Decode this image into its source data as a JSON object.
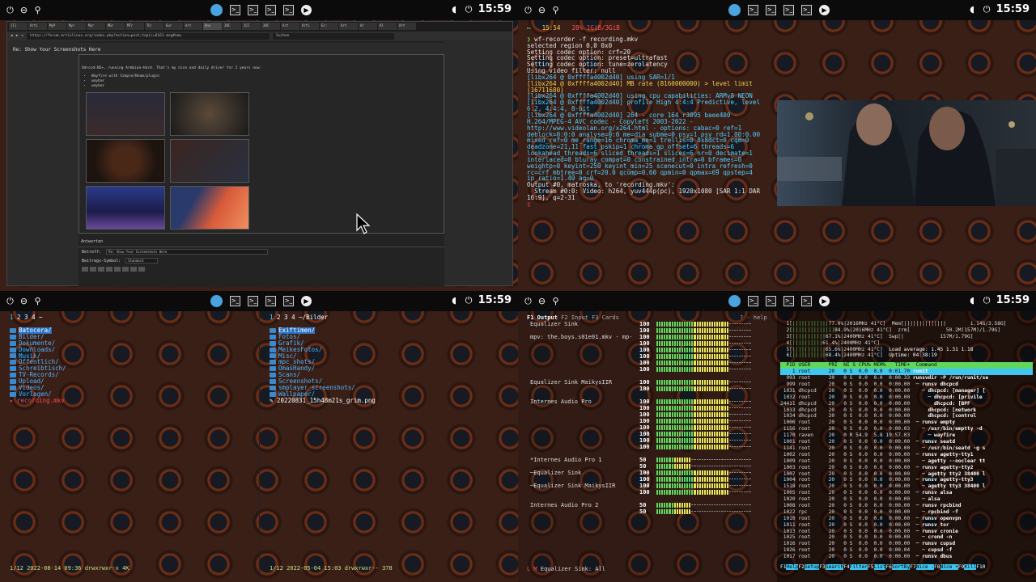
{
  "bar": {
    "clock": "15:59",
    "term_glyph": ">_"
  },
  "browser": {
    "tabs": [
      "[1]",
      "Arti",
      "MyP",
      "Myr",
      "Myr",
      "MGr",
      "MTr",
      "TO:",
      "Gur",
      "Art",
      "Ans",
      "20C",
      "2CC",
      "20C",
      "Art",
      "Arti",
      "Gr:",
      "Art",
      "Ar",
      "Al",
      "Art"
    ],
    "url": "https://forum.artixlinux.org/index.php?action=post;topic=6161.msg#new",
    "search_placeholder": "Suchen",
    "post_title": "Re: Show Your Screenshots Here",
    "post_intro": "Odroid-N2+, running Armbian-Hard. That's my nice and daily driver for 2 years now:",
    "post_items": [
      "Wayfire with Simple/Beam/plugin",
      "waybar",
      "waybar"
    ],
    "answer_title": "Antworten",
    "betreff_label": "Betreff:",
    "betreff_value": "Re: Show Your Screenshots Here",
    "symbol_label": "Beitrags-Symbol:",
    "symbol_value": "Standard"
  },
  "terminal": {
    "status_time": "15:54",
    "status_mem": "28% 1GiB/3GiB",
    "command": "wf-recorder -f recording.mkv",
    "lines": [
      {
        "t": "selected region 0,0 0x0",
        "c": ""
      },
      {
        "t": "Setting codec option: crf=20",
        "c": ""
      },
      {
        "t": "Setting codec option: preset=ultrafast",
        "c": ""
      },
      {
        "t": "Setting codec option: tune=zerolatency",
        "c": ""
      },
      {
        "t": "Using video filter: null",
        "c": ""
      },
      {
        "t": "[libx264 @ 0xffffa4002d40] using SAR=1/1",
        "c": "cyan"
      },
      {
        "t": "[libx264 @ 0xffffa4002d40] MB rate (8160000000) > level limit (16711680)",
        "c": "yel"
      },
      {
        "t": "[libx264 @ 0xffffa4002d40] using cpu capabilities: ARMv8 NEON",
        "c": "cyan"
      },
      {
        "t": "[libx264 @ 0xffffa4002d40] profile High 4:4:4 Predictive, level 6.2, 4:4:4, 8-bit",
        "c": "cyan"
      },
      {
        "t": "[libx264 @ 0xffffa4002d40] 264 - core 164 r3095 baee400 - H.264/MPEG-4 AVC codec - Copyleft 2003-2022 - http://www.videolan.org/x264.html - options: cabac=0 ref=1 deblock=0:0:0 analyse=0:0 me=dia subme=0 psy=1 psy_rd=1.00:0.00 mixed_ref=0 me_range=16 chroma_me=1 trellis=0 8x8dct=0 cqm=0 deadzone=21,11 fast_pskip=1 chroma_qp_offset=6 threads=6 lookahead_threads=6 sliced_threads=1 slices=6 nr=0 decimate=1 interlaced=0 bluray_compat=0 constrained_intra=0 bframes=0 weightp=0 keyint=250 keyint_min=25 scenecut=0 intra_refresh=0 rc=crf mbtree=0 crf=20.0 qcomp=0.60 qpmin=0 qpmax=69 qpstep=4 ip_ratio=1.40 aq=0",
        "c": "cyan"
      },
      {
        "t": "Output #0, matroska, to 'recording.mkv':",
        "c": ""
      },
      {
        "t": "  Stream #0:0: Video: h264, yuv444p(pc), 1920x1080 [SAR 1:1 DAR 16:9], q=2-31",
        "c": ""
      }
    ]
  },
  "ranger_left": {
    "tabs_cur": "1",
    "tabs_rest": "2 3 4 ~",
    "items": [
      {
        "name": "Batocera/",
        "type": "dir",
        "sel": true
      },
      {
        "name": "Bilder/",
        "type": "dir"
      },
      {
        "name": "Dokumente/",
        "type": "dir"
      },
      {
        "name": "Downloads/",
        "type": "dir"
      },
      {
        "name": "Musik/",
        "type": "dir"
      },
      {
        "name": "Öffentlich/",
        "type": "dir"
      },
      {
        "name": "Schreibtisch/",
        "type": "dir"
      },
      {
        "name": "TV-Records/",
        "type": "dir"
      },
      {
        "name": "Upload/",
        "type": "dir"
      },
      {
        "name": "Videos/",
        "type": "dir"
      },
      {
        "name": "Vorlagen/",
        "type": "dir"
      },
      {
        "name": "recording.mkv",
        "type": "file"
      }
    ],
    "status": "1/12 2022-08-14 09:36 drwxrwxr-x 4K"
  },
  "ranger_right": {
    "tabs_cur": "1",
    "tabs_rest": "2 3 4 ~/Bilder",
    "items": [
      {
        "name": "Exiftimen/",
        "type": "dir",
        "sel": true
      },
      {
        "name": "Fotos/",
        "type": "dir"
      },
      {
        "name": "Grafik/",
        "type": "dir"
      },
      {
        "name": "MeikesFotos/",
        "type": "dir"
      },
      {
        "name": "Misc/",
        "type": "dir"
      },
      {
        "name": "mpc_shots/",
        "type": "dir"
      },
      {
        "name": "OmasHandy/",
        "type": "dir"
      },
      {
        "name": "Scans/",
        "type": "dir"
      },
      {
        "name": "Screenshots/",
        "type": "dir"
      },
      {
        "name": "smplayer_screenshots/",
        "type": "dir"
      },
      {
        "name": "Wallpaper/",
        "type": "dir"
      },
      {
        "name": "20220831_15h48m21s_grim.png",
        "type": "img"
      }
    ],
    "status": "1/12 2022-05-04 15:03 drwxrwxr-- 378"
  },
  "mixer": {
    "tab_output": "F1 Output",
    "tab_input": "F2 Input",
    "tab_cards": "F3 Cards",
    "help": "? - help",
    "footer": "Equalizer Sink: All",
    "footer_prefix": "L M",
    "channels": [
      {
        "name": "Equalizer Sink",
        "vol": "100",
        "lvl": 1.0,
        "header": true
      },
      {
        "name": "",
        "vol": "100",
        "lvl": 1.0
      },
      {
        "name": "mpv: the.boys.s01e01.mkv - mp-",
        "vol": "100",
        "lvl": 1.0
      },
      {
        "name": "",
        "vol": "100",
        "lvl": 1.0
      },
      {
        "name": "",
        "vol": "100",
        "lvl": 1.0
      },
      {
        "name": "",
        "vol": "100",
        "lvl": 1.0
      },
      {
        "name": "",
        "vol": "100",
        "lvl": 1.0
      },
      {
        "name": "",
        "vol": "100",
        "lvl": 1.0
      },
      {
        "name": "",
        "gap": true
      },
      {
        "name": "Equalizer Sink MaikysIIR",
        "vol": "100",
        "lvl": 1.0
      },
      {
        "name": "",
        "vol": "100",
        "lvl": 1.0
      },
      {
        "name": "",
        "gap": true
      },
      {
        "name": "Internes Audio Pro",
        "vol": "100",
        "lvl": 1.0
      },
      {
        "name": "",
        "vol": "100",
        "lvl": 1.0
      },
      {
        "name": "",
        "vol": "100",
        "lvl": 1.0
      },
      {
        "name": "",
        "vol": "100",
        "lvl": 1.0
      },
      {
        "name": "",
        "vol": "100",
        "lvl": 1.0
      },
      {
        "name": "",
        "vol": "100",
        "lvl": 1.0
      },
      {
        "name": "",
        "vol": "100",
        "lvl": 1.0
      },
      {
        "name": "",
        "vol": "100",
        "lvl": 1.0
      },
      {
        "name": "",
        "gap": true
      },
      {
        "name": "*Internes Audio Pro 1",
        "vol": "50",
        "lvl": 0.5
      },
      {
        "name": "",
        "vol": "50",
        "lvl": 0.5
      },
      {
        "name": "─Equalizer Sink",
        "vol": "100",
        "lvl": 1.0
      },
      {
        "name": "",
        "vol": "100",
        "lvl": 1.0
      },
      {
        "name": "─Equalizer Sink MaikysIIR",
        "vol": "100",
        "lvl": 1.0
      },
      {
        "name": "",
        "vol": "100",
        "lvl": 1.0
      },
      {
        "name": "",
        "gap": true
      },
      {
        "name": "Internes Audio Pro 2",
        "vol": "50",
        "lvl": 0.5
      },
      {
        "name": "",
        "vol": "50",
        "lvl": 0.5
      }
    ]
  },
  "htop": {
    "cpus": [
      {
        "n": "1",
        "pct": "77.0%",
        "mhz": "2016MHz",
        "temp": "41°C",
        "lvl": 0.77
      },
      {
        "n": "2",
        "pct": "84.9%",
        "mhz": "2016MHz",
        "temp": "41°C",
        "lvl": 0.85
      },
      {
        "n": "3",
        "pct": "67.1%",
        "mhz": "2400MHz",
        "temp": "41°C",
        "lvl": 0.67
      },
      {
        "n": "4",
        "pct": "61.4%",
        "mhz": "2400MHz",
        "temp": "41°C",
        "lvl": 0.61
      },
      {
        "n": "5",
        "pct": "65.6%",
        "mhz": "2400MHz",
        "temp": "41°C",
        "lvl": 0.66
      },
      {
        "n": "6",
        "pct": "68.4%",
        "mhz": "2400MHz",
        "temp": "41°C",
        "lvl": 0.68
      }
    ],
    "mem": "1.14G/3.58G",
    "zrm": "50.2M(157M)/1.79G",
    "swp": "157M/1.79G",
    "load": "Load average: 1.45 1.31 1.18",
    "uptime": "Uptime: 04:38:19",
    "header": "  PID USER      PRI  NI S CPU% MEM%   TIME+  Command",
    "procs": [
      {
        "pid": "1",
        "user": "root",
        "pri": "20",
        "ni": "0",
        "s": "S",
        "cpu": "0.0",
        "mem": "0.0",
        "time": "0:01.70",
        "cmd": "runit",
        "sel": true
      },
      {
        "pid": "993",
        "user": "root",
        "pri": "20",
        "ni": "0",
        "s": "S",
        "cpu": "0.0",
        "mem": "0.0",
        "time": "0:00.33",
        "cmd": "runsvdir -P /run/runit/se"
      },
      {
        "pid": "999",
        "user": "root",
        "pri": "20",
        "ni": "0",
        "s": "S",
        "cpu": "0.0",
        "mem": "0.0",
        "time": "0:00.00",
        "cmd": " ─ runsv dhcpcd"
      },
      {
        "pid": "1031",
        "user": "dhcpcd",
        "pri": "20",
        "ni": "0",
        "s": "S",
        "cpu": "0.0",
        "mem": "0.0",
        "time": "0:00.00",
        "cmd": "   ─ dhcpcd: [manager] ["
      },
      {
        "pid": "1032",
        "user": "root",
        "pri": "20",
        "ni": "0",
        "s": "S",
        "cpu": "0.0",
        "mem": "0.0",
        "time": "0:00.00",
        "cmd": "     ─ dhcpcd: [privile"
      },
      {
        "pid": "24411",
        "user": "dhcpcd",
        "pri": "20",
        "ni": "0",
        "s": "S",
        "cpu": "0.0",
        "mem": "0.0",
        "time": "0:00.00",
        "cmd": "       dhcpcd: [BPF"
      },
      {
        "pid": "1033",
        "user": "dhcpcd",
        "pri": "20",
        "ni": "0",
        "s": "S",
        "cpu": "0.0",
        "mem": "0.0",
        "time": "0:00.00",
        "cmd": "     dhcpcd: [network"
      },
      {
        "pid": "1034",
        "user": "dhcpcd",
        "pri": "20",
        "ni": "0",
        "s": "S",
        "cpu": "0.0",
        "mem": "0.0",
        "time": "0:00.00",
        "cmd": "     dhcpcd: [control"
      },
      {
        "pid": "1000",
        "user": "root",
        "pri": "20",
        "ni": "0",
        "s": "S",
        "cpu": "0.0",
        "mem": "0.0",
        "time": "0:00.00",
        "cmd": " ─ runsv empty"
      },
      {
        "pid": "1156",
        "user": "root",
        "pri": "20",
        "ni": "0",
        "s": "S",
        "cpu": "0.0",
        "mem": "0.0",
        "time": "0:00.03",
        "cmd": "   ─ /usr/bin/emptty -d"
      },
      {
        "pid": "1170",
        "user": "raven",
        "pri": "20",
        "ni": "0",
        "s": "R",
        "cpu": "54.9",
        "mem": "5.8",
        "time": "19:57.03",
        "cmd": "     ─ wayfire"
      },
      {
        "pid": "1001",
        "user": "root",
        "pri": "20",
        "ni": "0",
        "s": "S",
        "cpu": "0.0",
        "mem": "0.0",
        "time": "0:00.00",
        "cmd": " ─ runsv seatd"
      },
      {
        "pid": "1141",
        "user": "root",
        "pri": "20",
        "ni": "0",
        "s": "S",
        "cpu": "0.0",
        "mem": "0.0",
        "time": "0:00.00",
        "cmd": "   ─ /usr/bin/seatd -g s"
      },
      {
        "pid": "1002",
        "user": "root",
        "pri": "20",
        "ni": "0",
        "s": "S",
        "cpu": "0.0",
        "mem": "0.0",
        "time": "0:00.00",
        "cmd": " ─ runsv agetty-tty1"
      },
      {
        "pid": "1009",
        "user": "root",
        "pri": "20",
        "ni": "0",
        "s": "S",
        "cpu": "0.0",
        "mem": "0.0",
        "time": "0:00.00",
        "cmd": "   ─ agetty --noclear tt"
      },
      {
        "pid": "1003",
        "user": "root",
        "pri": "20",
        "ni": "0",
        "s": "S",
        "cpu": "0.0",
        "mem": "0.0",
        "time": "0:00.00",
        "cmd": " ─ runsv agetty-tty2"
      },
      {
        "pid": "1007",
        "user": "root",
        "pri": "20",
        "ni": "0",
        "s": "S",
        "cpu": "0.0",
        "mem": "0.0",
        "time": "0:00.00",
        "cmd": "   ─ agetty tty2 38400 l"
      },
      {
        "pid": "1004",
        "user": "root",
        "pri": "20",
        "ni": "0",
        "s": "S",
        "cpu": "0.0",
        "mem": "0.0",
        "time": "0:00.00",
        "cmd": " ─ runsv agetty-tty3"
      },
      {
        "pid": "1518",
        "user": "root",
        "pri": "20",
        "ni": "0",
        "s": "S",
        "cpu": "0.0",
        "mem": "0.0",
        "time": "0:00.00",
        "cmd": "   ─ agetty tty3 38400 l"
      },
      {
        "pid": "1005",
        "user": "root",
        "pri": "20",
        "ni": "0",
        "s": "S",
        "cpu": "0.0",
        "mem": "0.0",
        "time": "0:00.00",
        "cmd": " ─ runsv alsa"
      },
      {
        "pid": "1020",
        "user": "root",
        "pri": "20",
        "ni": "0",
        "s": "S",
        "cpu": "0.0",
        "mem": "0.0",
        "time": "0:00.00",
        "cmd": "   ─ alsa"
      },
      {
        "pid": "1008",
        "user": "root",
        "pri": "20",
        "ni": "0",
        "s": "S",
        "cpu": "0.0",
        "mem": "0.0",
        "time": "0:00.00",
        "cmd": " ─ runsv rpcbind"
      },
      {
        "pid": "1022",
        "user": "rpc",
        "pri": "20",
        "ni": "0",
        "s": "S",
        "cpu": "0.0",
        "mem": "0.0",
        "time": "0:00.00",
        "cmd": "   ─ rpcbind -f"
      },
      {
        "pid": "1010",
        "user": "root",
        "pri": "20",
        "ni": "0",
        "s": "S",
        "cpu": "0.0",
        "mem": "0.0",
        "time": "0:00.00",
        "cmd": " ─ runsv openvpn"
      },
      {
        "pid": "1011",
        "user": "root",
        "pri": "20",
        "ni": "0",
        "s": "S",
        "cpu": "0.0",
        "mem": "0.0",
        "time": "0:00.00",
        "cmd": " ─ runsv tor"
      },
      {
        "pid": "1013",
        "user": "root",
        "pri": "20",
        "ni": "0",
        "s": "S",
        "cpu": "0.0",
        "mem": "0.0",
        "time": "0:00.00",
        "cmd": " ─ runsv cronie"
      },
      {
        "pid": "1025",
        "user": "root",
        "pri": "20",
        "ni": "0",
        "s": "S",
        "cpu": "0.0",
        "mem": "0.0",
        "time": "0:00.00",
        "cmd": "   ─ crond -n"
      },
      {
        "pid": "1016",
        "user": "root",
        "pri": "20",
        "ni": "0",
        "s": "S",
        "cpu": "0.0",
        "mem": "0.0",
        "time": "0:00.00",
        "cmd": " ─ runsv cupsd"
      },
      {
        "pid": "1026",
        "user": "root",
        "pri": "20",
        "ni": "0",
        "s": "S",
        "cpu": "0.0",
        "mem": "0.0",
        "time": "0:00.04",
        "cmd": "   ─ cupsd -f"
      },
      {
        "pid": "1017",
        "user": "root",
        "pri": "20",
        "ni": "0",
        "s": "S",
        "cpu": "0.0",
        "mem": "0.0",
        "time": "0:00.00",
        "cmd": " ─ runsv dbus"
      }
    ],
    "fkeys": [
      {
        "k": "F1",
        "l": "Help"
      },
      {
        "k": "F2",
        "l": "Setup"
      },
      {
        "k": "F3",
        "l": "Search"
      },
      {
        "k": "F4",
        "l": "Filter"
      },
      {
        "k": "F5",
        "l": "List"
      },
      {
        "k": "F6",
        "l": "SortBy"
      },
      {
        "k": "F7",
        "l": "Nice -"
      },
      {
        "k": "F8",
        "l": "Nice +"
      },
      {
        "k": "F9",
        "l": "Kill"
      },
      {
        "k": "F10",
        "l": ""
      }
    ]
  },
  "colors": {
    "meter_green": "#5fd75f",
    "meter_yellow": "#e6e65a",
    "htop_green": "#5fd75f",
    "htop_cyan": "#3ec6f0"
  }
}
